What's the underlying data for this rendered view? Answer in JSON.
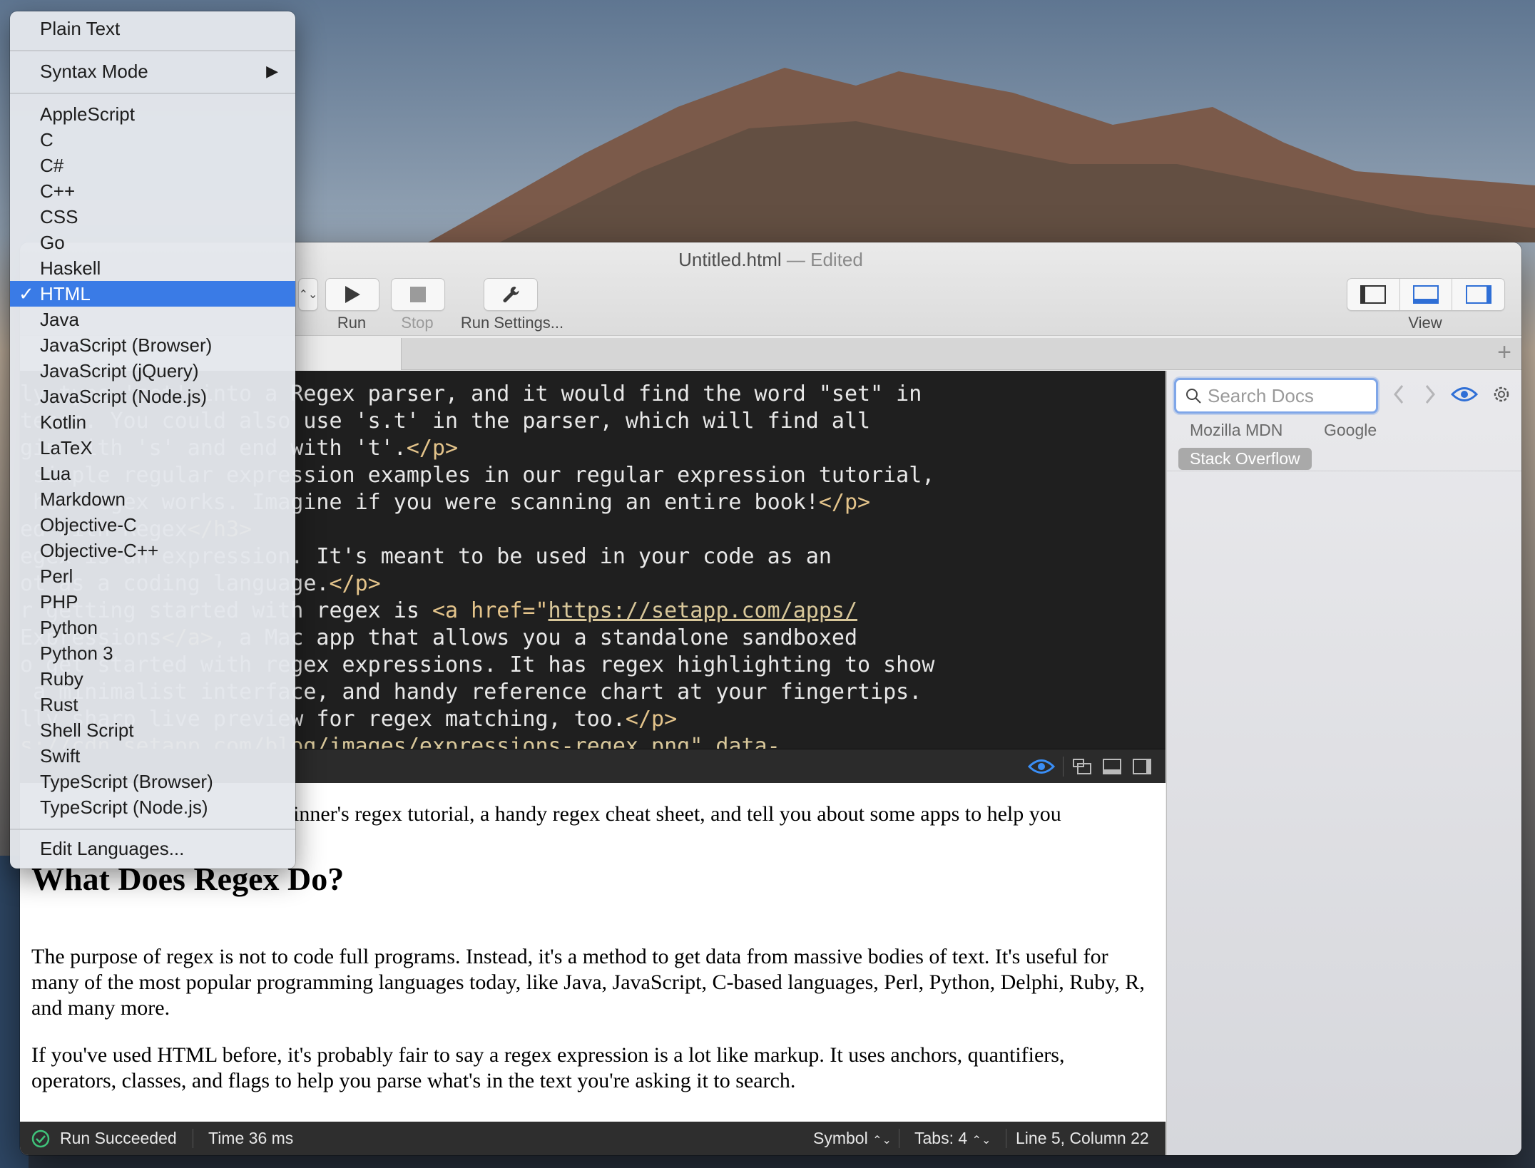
{
  "window": {
    "title": "Untitled.html",
    "title_suffix": "— Edited"
  },
  "toolbar": {
    "run_label": "Run",
    "stop_label": "Stop",
    "run_settings_label": "Run Settings...",
    "view_label": "View"
  },
  "menu": {
    "plain_text": "Plain Text",
    "syntax_mode": "Syntax Mode",
    "languages": [
      "AppleScript",
      "C",
      "C#",
      "C++",
      "CSS",
      "Go",
      "Haskell",
      "HTML",
      "Java",
      "JavaScript (Browser)",
      "JavaScript (jQuery)",
      "JavaScript (Node.js)",
      "Kotlin",
      "LaTeX",
      "Lua",
      "Markdown",
      "Objective-C",
      "Objective-C++",
      "Perl",
      "PHP",
      "Python",
      "Python 3",
      "Ruby",
      "Rust",
      "Shell Script",
      "Swift",
      "TypeScript (Browser)",
      "TypeScript (Node.js)"
    ],
    "selected": "HTML",
    "check_mark": "✓",
    "edit_languages": "Edit Languages..."
  },
  "editor": {
    "lines": [
      {
        "text": "ly type 'set' into a Regex parser, and it would find the word \"set\" in"
      },
      {
        "text": "tence. You could also use 's.t' in the parser, which will find all"
      },
      {
        "text": "gin with 's' and end with 't'.",
        "tag": "</p>"
      },
      {
        "text": " simple regular expression examples in our regular expression tutorial,"
      },
      {
        "text": " how regex works. Imagine if you were scanning an entire book!",
        "tag": "</p>"
      },
      {
        "text": "ed with Regex",
        "tag": "</h3>"
      },
      {
        "text": "egex is an expression. It's meant to be used in your code as an"
      },
      {
        "text": "ot as a coding language.",
        "tag": "</p>"
      },
      {
        "text": "r getting started with regex is ",
        "tag": "<a href=\"",
        "url": "https://setapp.com/apps/"
      },
      {
        "text": "Expressions",
        "tag": "</a>",
        "rest": ", a Mac app that allows you a standalone sandboxed"
      },
      {
        "text": "o get started with regex expressions. It has regex highlighting to show"
      },
      {
        "text": " a minimalist interface, and handy reference chart at your fingertips."
      },
      {
        "text": "lly sharp live preview for regex matching, too.",
        "tag": "</p>"
      },
      {
        "url": "s://cdn.setapp.com/blog/images/expressions-regex.png\" data-"
      }
    ]
  },
  "preview": {
    "intro_fragment": "inner's regex tutorial, a handy regex cheat sheet, and tell you about some apps to help you",
    "heading": "What Does Regex Do?",
    "para1": "The purpose of regex is not to code full programs. Instead, it's a method to get data from massive bodies of text. It's useful for many of the most popular programming languages today, like Java, JavaScript, C-based languages, Perl, Python, Delphi, Ruby, R, and many more.",
    "para2": "If you've used HTML before, it's probably fair to say a regex expression is a lot like markup. It uses anchors, quantifiers, operators, classes, and flags to help you parse what's in the text you're asking it to search."
  },
  "statusbar": {
    "run_status": "Run Succeeded",
    "time": "Time 36 ms",
    "symbol": "Symbol",
    "tabs": "Tabs: 4",
    "position": "Line 5, Column 22"
  },
  "docs": {
    "search_placeholder": "Search Docs",
    "links": [
      "Mozilla MDN",
      "Google",
      "Stack Overflow"
    ],
    "active": "Stack Overflow"
  },
  "colors": {
    "accent": "#3a7be6",
    "editor_bg": "#1f1f1f",
    "tag": "#e4c48b",
    "success": "#3fc37a"
  }
}
